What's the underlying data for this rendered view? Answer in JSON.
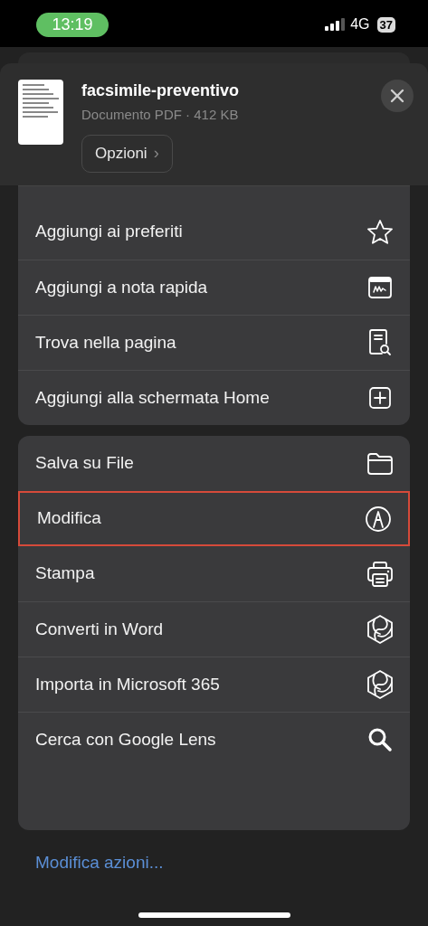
{
  "status_bar": {
    "time": "13:19",
    "network": "4G",
    "battery": "37"
  },
  "file": {
    "name": "facsimile-preventivo",
    "details": "Documento PDF · 412 KB",
    "options_button": "Opzioni",
    "chevron": "›"
  },
  "groups": [
    {
      "items": [
        {
          "label": "Aggiungi ai preferiti",
          "highlighted": false
        },
        {
          "label": "Aggiungi a nota rapida",
          "highlighted": false
        },
        {
          "label": "Trova nella pagina",
          "highlighted": false
        },
        {
          "label": "Aggiungi alla schermata Home",
          "highlighted": false
        }
      ]
    },
    {
      "items": [
        {
          "label": "Salva su File",
          "highlighted": false
        },
        {
          "label": "Modifica",
          "highlighted": true
        },
        {
          "label": "Stampa",
          "highlighted": false
        },
        {
          "label": "Converti in Word",
          "highlighted": false
        },
        {
          "label": "Importa in Microsoft 365",
          "highlighted": false
        },
        {
          "label": "Cerca con Google Lens",
          "highlighted": false
        }
      ]
    }
  ],
  "edit_actions_link": "Modifica azioni..."
}
